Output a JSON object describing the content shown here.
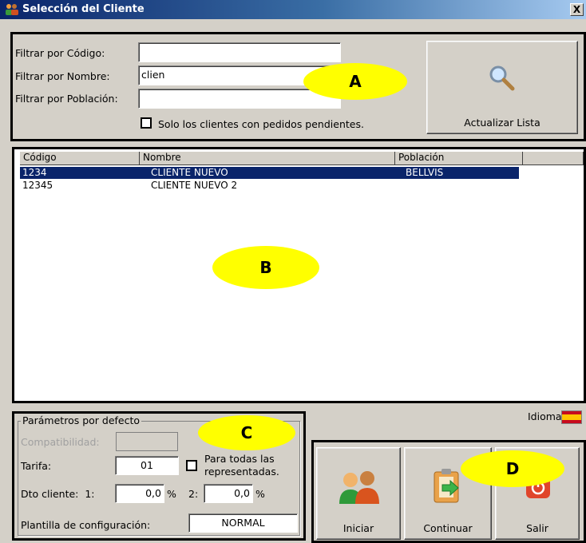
{
  "window": {
    "title": "Selección del Cliente",
    "close_label": "X"
  },
  "filters": {
    "code_label": "Filtrar por Código:",
    "name_label": "Filtrar por Nombre:",
    "town_label": "Filtrar por Población:",
    "code_value": "",
    "name_value": "clien",
    "town_value": "",
    "pending_label": "Solo los clientes con pedidos pendientes.",
    "refresh_label": "Actualizar Lista"
  },
  "callouts": {
    "a": "A",
    "b": "B",
    "c": "C",
    "d": "D"
  },
  "list": {
    "columns": [
      "Código",
      "Nombre",
      "Población"
    ],
    "rows": [
      {
        "code": "1234",
        "name": "CLIENTE NUEVO",
        "town": "BELLVIS",
        "selected": true
      },
      {
        "code": "12345",
        "name": "CLIENTE NUEVO 2",
        "town": "",
        "selected": false
      }
    ]
  },
  "defaults": {
    "group_title": "Parámetros por defecto",
    "compat_label": "Compatibilidad:",
    "tarifa_label": "Tarifa:",
    "tarifa_value": "01",
    "all_reps_label_1": "Para todas las",
    "all_reps_label_2": "representadas.",
    "dto_label": "Dto cliente:  1:",
    "dto1_value": "0,0",
    "pct1": "%",
    "dto2_label": "2:",
    "dto2_value": "0,0",
    "pct2": "%",
    "template_label": "Plantilla de configuración:",
    "template_value": "NORMAL"
  },
  "language": {
    "label": "Idioma:",
    "flag": "spain-flag-icon"
  },
  "actions": {
    "start_label": "Iniciar",
    "continue_label": "Continuar",
    "exit_label": "Salir"
  }
}
